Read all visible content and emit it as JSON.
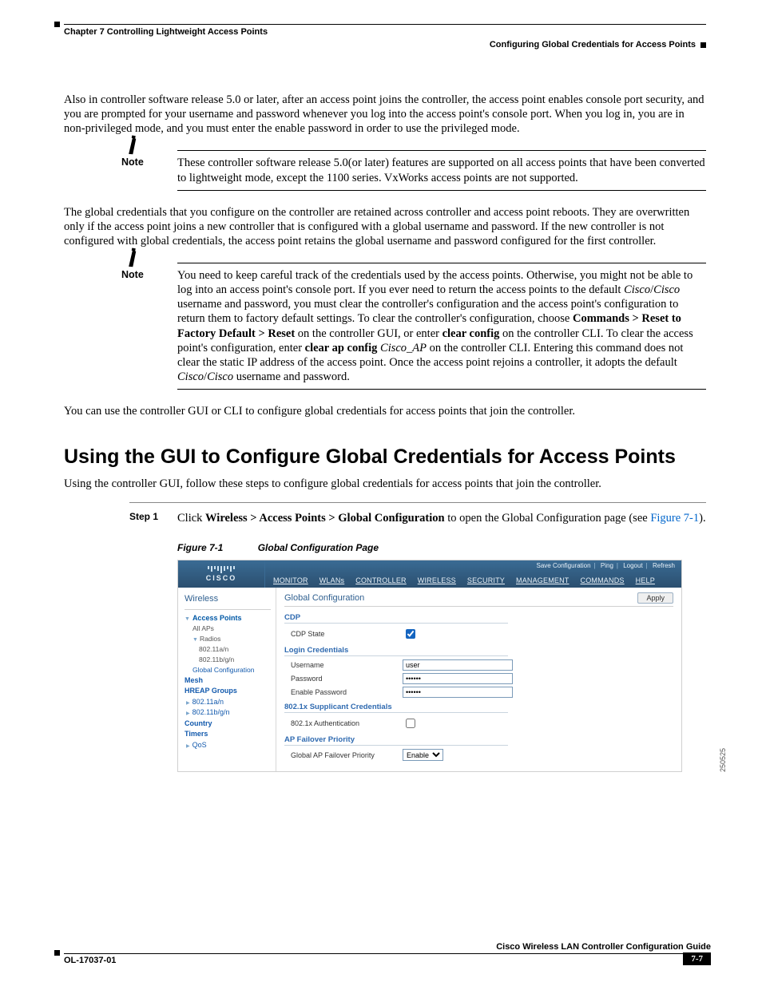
{
  "header": {
    "chapter": "Chapter 7      Controlling Lightweight Access Points",
    "section_right": "Configuring Global Credentials for Access Points"
  },
  "para1": "Also in controller software release 5.0 or later, after an access point joins the controller, the access point enables console port security, and you are prompted for your username and password whenever you log into the access point's console port. When you log in, you are in non-privileged mode, and you must enter the enable password in order to use the privileged mode.",
  "note1_label": "Note",
  "note1_text": "These controller software release 5.0(or later) features are supported on all access points that have been converted to lightweight mode, except the 1100 series. VxWorks access points are not supported.",
  "para2": "The global credentials that you configure on the controller are retained across controller and access point reboots. They are overwritten only if the access point joins a new controller that is configured with a global username and password. If the new controller is not configured with global credentials, the access point retains the global username and password configured for the first controller.",
  "note2_label": "Note",
  "note2_pre": "You need to keep careful track of the credentials used by the access points. Otherwise, you might not be able to log into an access point's console port. If you ever need to return the access points to the default ",
  "note2_cisco1a": "Cisco",
  "note2_slash1": "/",
  "note2_cisco1b": "Cisco",
  "note2_mid1": " username and password, you must clear the controller's configuration and the access point's configuration to return them to factory default settings. To clear the controller's configuration, choose ",
  "note2_path": "Commands > Reset to Factory Default > Reset",
  "note2_mid2": " on the controller GUI, or enter ",
  "note2_cmd1": "clear config",
  "note2_mid3": " on the controller CLI. To clear the access point's configuration, enter ",
  "note2_cmd2": "clear ap config",
  "note2_cmd2_arg": " Cisco_AP",
  "note2_mid4": " on the controller CLI. Entering this command does not clear the static IP address of the access point. Once the access point rejoins a controller, it adopts the default ",
  "note2_cisco2a": "Cisco",
  "note2_slash2": "/",
  "note2_cisco2b": "Cisco",
  "note2_tail": " username and password.",
  "para3": "You can use the controller GUI or CLI to configure global credentials for access points that join the controller.",
  "h2": "Using the GUI to Configure Global Credentials for Access Points",
  "para4": "Using the controller GUI, follow these steps to configure global credentials for access points that join the controller.",
  "step1_label": "Step 1",
  "step1_pre": "Click ",
  "step1_path": "Wireless > Access Points > Global Configuration",
  "step1_mid": " to open the Global Configuration page (see ",
  "step1_figref": "Figure 7-1",
  "step1_tail": ").",
  "figure_num": "Figure 7-1",
  "figure_title": "Global Configuration Page",
  "gui": {
    "logo_text": "CISCO",
    "util": {
      "save": "Save Configuration",
      "ping": "Ping",
      "logout": "Logout",
      "refresh": "Refresh"
    },
    "menu": [
      "MONITOR",
      "WLANs",
      "CONTROLLER",
      "WIRELESS",
      "SECURITY",
      "MANAGEMENT",
      "COMMANDS",
      "HELP"
    ],
    "side": {
      "title": "Wireless",
      "ap": "Access Points",
      "ap_all": "All APs",
      "radios": "Radios",
      "r1": "802.11a/n",
      "r2": "802.11b/g/n",
      "gconf": "Global Configuration",
      "mesh": "Mesh",
      "hreap": "HREAP Groups",
      "s80211a": "802.11a/n",
      "s80211b": "802.11b/g/n",
      "country": "Country",
      "timers": "Timers",
      "qos": "QoS"
    },
    "main": {
      "title": "Global Configuration",
      "apply": "Apply",
      "cdp_h": "CDP",
      "cdp_state": "CDP State",
      "login_h": "Login Credentials",
      "username_lbl": "Username",
      "username_val": "user",
      "password_lbl": "Password",
      "enablepw_lbl": "Enable Password",
      "sup_h": "802.1x Supplicant Credentials",
      "auth_lbl": "802.1x Authentication",
      "fail_h": "AP Failover Priority",
      "fail_lbl": "Global AP Failover Priority",
      "fail_opt": "Enable"
    },
    "sidecode": "250525"
  },
  "footer": {
    "guide": "Cisco Wireless LAN Controller Configuration Guide",
    "docnum": "OL-17037-01",
    "pagenum": "7-7"
  }
}
